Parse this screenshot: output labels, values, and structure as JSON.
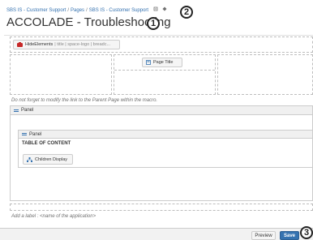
{
  "breadcrumb": {
    "items": [
      "SBS IS - Customer Support",
      "Pages",
      "SBS IS - Customer Support"
    ],
    "separator": "/"
  },
  "page": {
    "title": "ACCOLADE - Troubleshooting"
  },
  "callouts": [
    "1",
    "2",
    "3"
  ],
  "macros": {
    "hide_elements": {
      "label": "HideElements",
      "params": "| title | space-logo | breadc..."
    },
    "page_title": {
      "label": "Page Title"
    },
    "parent_hint": "Do not forget to modify the link to the Parent Page within the macro.",
    "outer_panel": {
      "label": "Panel"
    },
    "inner_panel": {
      "label": "Panel",
      "heading": "TABLE OF CONTENT"
    },
    "children_display": {
      "label": "Children Display"
    },
    "label_hint": "Add a label : <name of the application>"
  },
  "footer": {
    "preview_label": "Preview",
    "save_label": "Save"
  },
  "colors": {
    "link": "#3572b0",
    "primary_button": "#3572b0",
    "hide_elements_icon": "#c62828"
  }
}
